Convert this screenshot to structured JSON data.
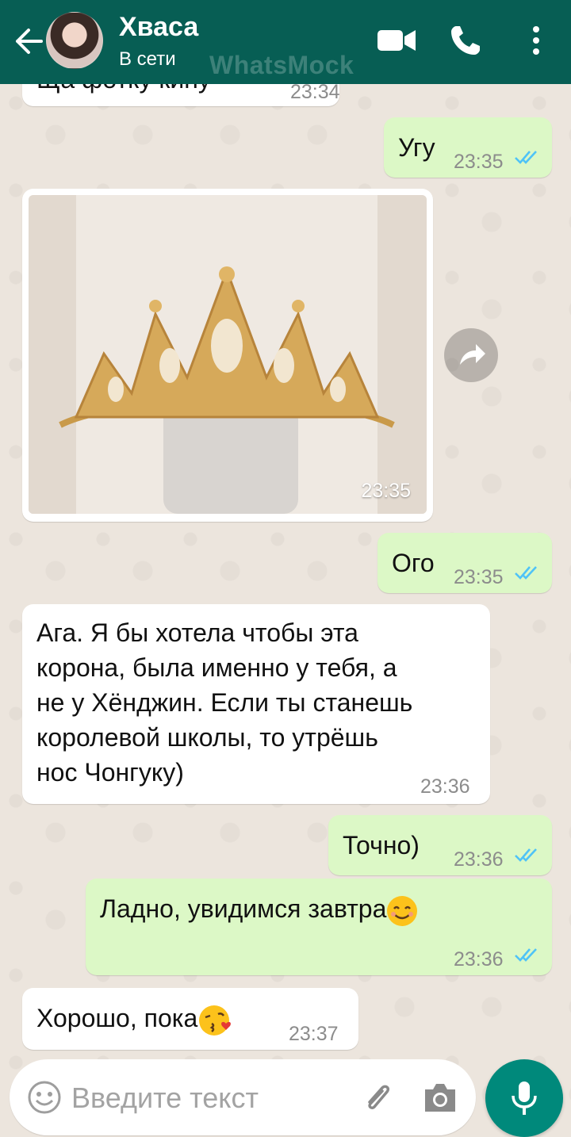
{
  "header": {
    "contact_name": "Хваса",
    "contact_status": "В сети",
    "watermark": "WhatsMock"
  },
  "messages": [
    {
      "dir": "in",
      "text": "Ща фотку кину",
      "time": "23:34"
    },
    {
      "dir": "out",
      "text": "Угу",
      "time": "23:35",
      "status": "read"
    },
    {
      "dir": "in",
      "type": "image",
      "description": "gold crown tiara",
      "time": "23:35"
    },
    {
      "dir": "out",
      "text": "Ого",
      "time": "23:35",
      "status": "read"
    },
    {
      "dir": "in",
      "lines": [
        "Ага. Я бы хотела чтобы эта",
        "корона, была именно у тебя, а",
        "не у Хёнджин. Если ты станешь",
        "королевой школы, то утрёшь",
        "нос Чонгуку)"
      ],
      "time": "23:36"
    },
    {
      "dir": "out",
      "text": "Точно)",
      "time": "23:36",
      "status": "read"
    },
    {
      "dir": "out",
      "text": "Ладно, увидимся завтра",
      "emoji": "smiling-face-icon",
      "time": "23:36",
      "status": "read"
    },
    {
      "dir": "in",
      "text": "Хорошо, пока",
      "emoji": "kissing-face-icon",
      "time": "23:37"
    }
  ],
  "input": {
    "placeholder": "Введите текст"
  },
  "colors": {
    "header": "#075e54",
    "outgoing": "#dcf8c6",
    "incoming": "#ffffff",
    "read_ticks": "#4fc3f7",
    "mic_button": "#00897b"
  },
  "icons": [
    "back-arrow-icon",
    "video-call-icon",
    "phone-icon",
    "more-vert-icon",
    "share-icon",
    "emoji-icon",
    "attach-icon",
    "camera-icon",
    "mic-icon"
  ]
}
